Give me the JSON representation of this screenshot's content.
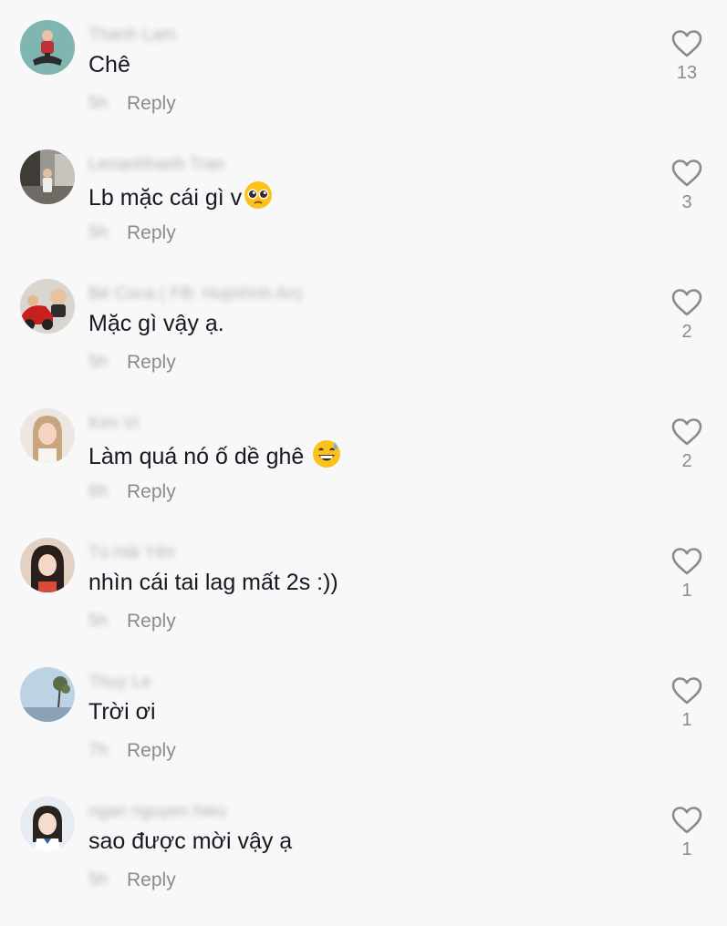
{
  "comments": [
    {
      "username": "Thanh Lam",
      "text": "Chê",
      "emoji": "",
      "time": "5h",
      "reply_label": "Reply",
      "likes": "13",
      "avatar_icon": "avatar-person-sitting"
    },
    {
      "username": "Lenanhhanh Tran",
      "text": "Lb mặc cái gì v",
      "emoji": "pleading-face",
      "time": "5h",
      "reply_label": "Reply",
      "likes": "3",
      "avatar_icon": "avatar-street-photo"
    },
    {
      "username": "Bé Coca ( FB: Huỳnhnh An)",
      "text": "Mặc gì vậy ạ.",
      "emoji": "",
      "time": "5h",
      "reply_label": "Reply",
      "likes": "2",
      "avatar_icon": "avatar-child-in-car"
    },
    {
      "username": "Kim Vi",
      "text": "Làm quá nó ố dề ghê ",
      "emoji": "grinning-sweat-face",
      "time": "6h",
      "reply_label": "Reply",
      "likes": "2",
      "avatar_icon": "avatar-girl-blonde"
    },
    {
      "username": "Tú Hải Yến",
      "text": "nhìn cái tai lag mất 2s :))",
      "emoji": "",
      "time": "5h",
      "reply_label": "Reply",
      "likes": "1",
      "avatar_icon": "avatar-girl-dark-hair"
    },
    {
      "username": "Thuy Le",
      "text": "Trời ơi",
      "emoji": "",
      "time": "7h",
      "reply_label": "Reply",
      "likes": "1",
      "avatar_icon": "avatar-sky-tree"
    },
    {
      "username": "ngan nguyen hieu",
      "text": "sao được mời vậy ạ",
      "emoji": "",
      "time": "5h",
      "reply_label": "Reply",
      "likes": "1",
      "avatar_icon": "avatar-girl-uniform"
    }
  ],
  "colors": {
    "background": "#f8f8f8",
    "text": "#161823",
    "muted": "#8a8b91",
    "heart_outline": "#8a8b91"
  }
}
